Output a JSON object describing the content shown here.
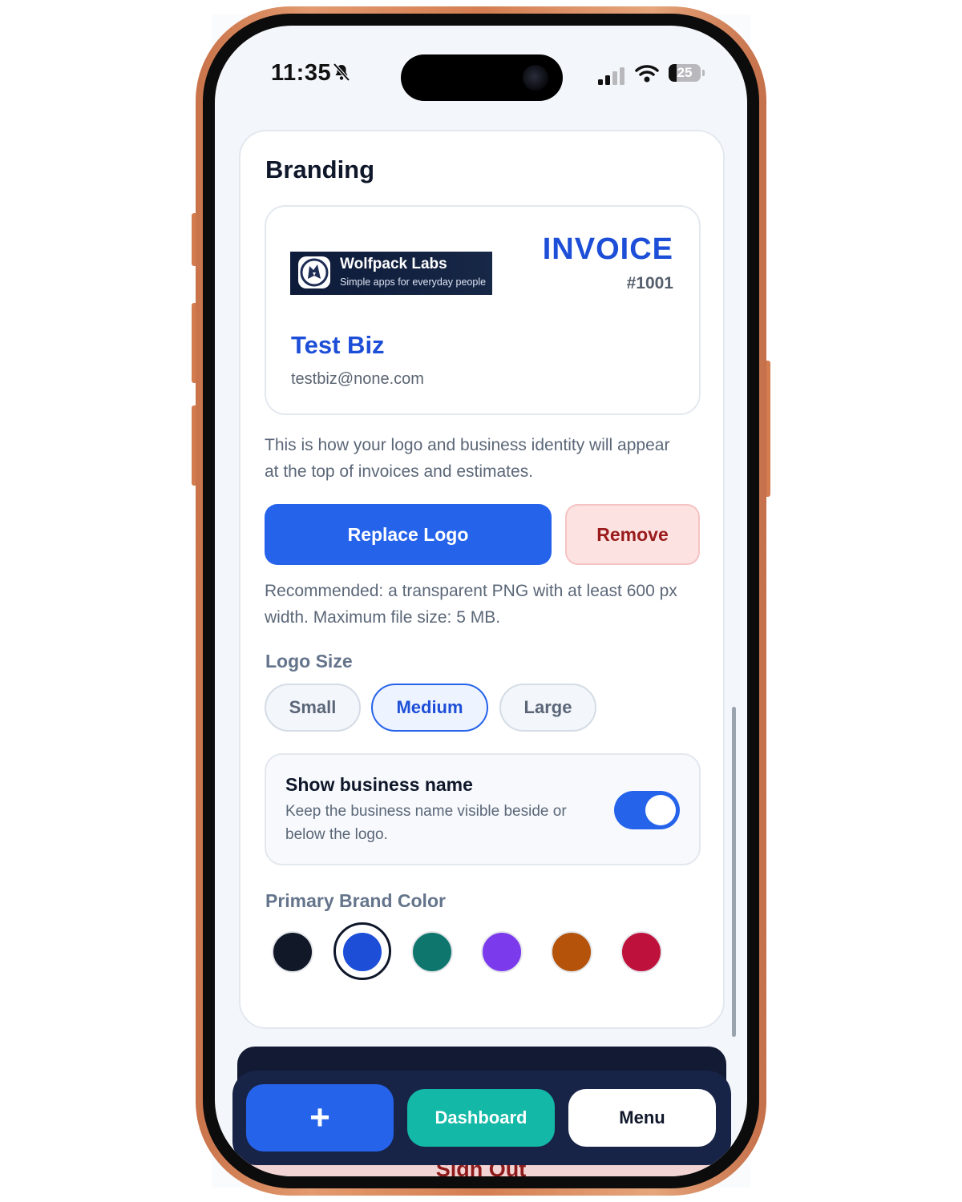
{
  "status_bar": {
    "time": "11:35",
    "battery": "25",
    "battery_level": 0.25
  },
  "branding": {
    "title": "Branding",
    "preview": {
      "logo_name": "Wolfpack Labs",
      "logo_tagline": "Simple apps for everyday people",
      "invoice_title": "INVOICE",
      "invoice_number": "#1001",
      "business_name": "Test Biz",
      "business_email": "testbiz@none.com"
    },
    "description": "This is how your logo and business identity will appear at the top of invoices and estimates.",
    "replace_logo_label": "Replace Logo",
    "remove_label": "Remove",
    "recommendation": "Recommended: a transparent PNG with at least 600 px width. Maximum file size: 5 MB.",
    "logo_size": {
      "label": "Logo Size",
      "options": [
        "Small",
        "Medium",
        "Large"
      ],
      "selected": "Medium"
    },
    "show_business_name": {
      "title": "Show business name",
      "description": "Keep the business name visible beside or below the logo.",
      "enabled": true
    },
    "brand_color": {
      "label": "Primary Brand Color",
      "swatches": [
        "#111827",
        "#1d4ed8",
        "#0f766e",
        "#7c3aed",
        "#b45309",
        "#be123c"
      ],
      "selected_index": 1
    }
  },
  "bottom_nav": {
    "add_label": "+",
    "dashboard_label": "Dashboard",
    "menu_label": "Menu"
  },
  "sign_out_label": "Sign Out",
  "colors": {
    "accent": "#2563eb",
    "teal": "#14b8a6",
    "danger": "#991b1b",
    "nav_bg": "#172347"
  }
}
